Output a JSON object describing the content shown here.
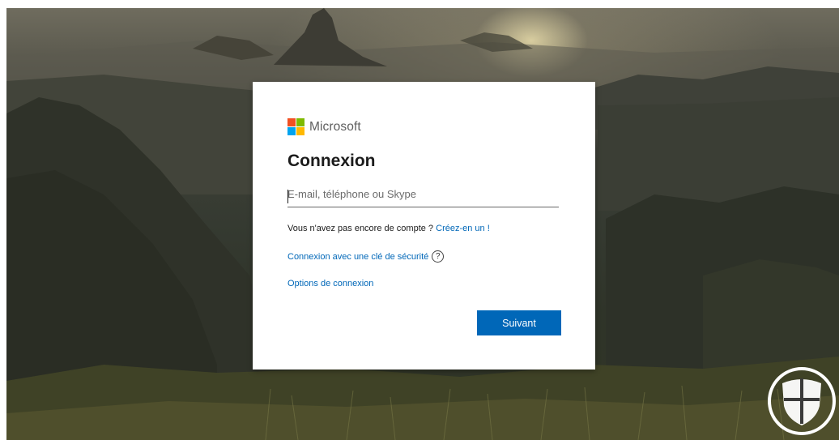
{
  "brand": {
    "name": "Microsoft",
    "colors": [
      "#f25022",
      "#7fba00",
      "#00a4ef",
      "#ffb900"
    ]
  },
  "signin": {
    "title": "Connexion",
    "input_placeholder": "E-mail, téléphone ou Skype",
    "input_value": "",
    "no_account_text": "Vous n'avez pas encore de compte ?",
    "create_link": "Créez-en un !",
    "security_key_link": "Connexion avec une clé de sécurité",
    "help_icon": "?",
    "options_link": "Options de connexion",
    "next_button": "Suivant"
  },
  "accent_color": "#0067b8",
  "watermark_icon": "windows-shield-icon"
}
